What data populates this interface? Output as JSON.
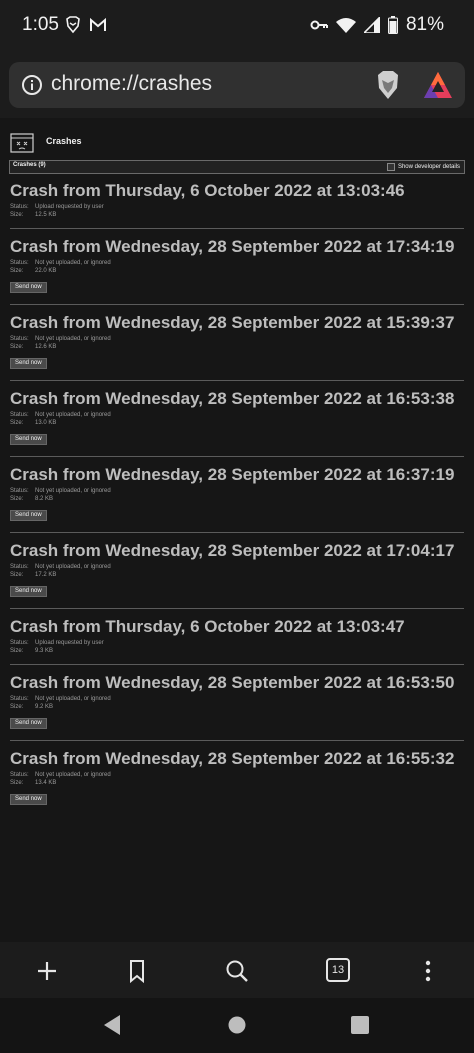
{
  "status_bar": {
    "time": "1:05",
    "battery": "81%"
  },
  "omnibox": {
    "url": "chrome://crashes"
  },
  "page": {
    "title": "Crashes",
    "summary": "Crashes (9)",
    "dev_details_label": "Show developer details",
    "status_label": "Status:",
    "size_label": "Size:",
    "send_label": "Send now"
  },
  "crashes": [
    {
      "title": "Crash from Thursday, 6 October 2022 at 13:03:46",
      "status": "Upload requested by user",
      "size": "12.5 KB",
      "send": false
    },
    {
      "title": "Crash from Wednesday, 28 September 2022 at 17:34:19",
      "status": "Not yet uploaded, or ignored",
      "size": "22.0 KB",
      "send": true
    },
    {
      "title": "Crash from Wednesday, 28 September 2022 at 15:39:37",
      "status": "Not yet uploaded, or ignored",
      "size": "12.6 KB",
      "send": true
    },
    {
      "title": "Crash from Wednesday, 28 September 2022 at 16:53:38",
      "status": "Not yet uploaded, or ignored",
      "size": "13.0 KB",
      "send": true
    },
    {
      "title": "Crash from Wednesday, 28 September 2022 at 16:37:19",
      "status": "Not yet uploaded, or ignored",
      "size": "8.2 KB",
      "send": true
    },
    {
      "title": "Crash from Wednesday, 28 September 2022 at 17:04:17",
      "status": "Not yet uploaded, or ignored",
      "size": "17.2 KB",
      "send": true
    },
    {
      "title": "Crash from Thursday, 6 October 2022 at 13:03:47",
      "status": "Upload requested by user",
      "size": "9.3 KB",
      "send": false
    },
    {
      "title": "Crash from Wednesday, 28 September 2022 at 16:53:50",
      "status": "Not yet uploaded, or ignored",
      "size": "9.2 KB",
      "send": true
    },
    {
      "title": "Crash from Wednesday, 28 September 2022 at 16:55:32",
      "status": "Not yet uploaded, or ignored",
      "size": "13.4 KB",
      "send": true
    }
  ],
  "bottom_bar": {
    "tab_count": "13"
  },
  "icons": {
    "status": [
      "brave-icon",
      "gmail-icon",
      "vpn-key-icon",
      "wifi-icon",
      "signal-icon",
      "battery-icon"
    ],
    "toolbar": [
      "info-icon",
      "brave-shield-icon",
      "bat-rewards-icon"
    ],
    "bottom": [
      "new-tab-icon",
      "bookmark-icon",
      "search-icon",
      "tab-switcher-icon",
      "more-icon"
    ],
    "nav": [
      "back-icon",
      "home-icon",
      "recents-icon"
    ]
  }
}
